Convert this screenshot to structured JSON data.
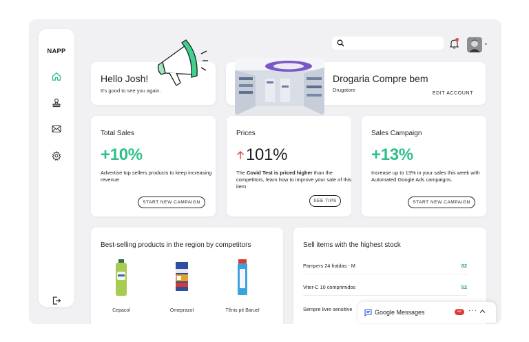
{
  "app": {
    "logo": "NAPP"
  },
  "sidebar": {
    "items": [
      {
        "icon": "home-icon"
      },
      {
        "icon": "stamp-icon"
      },
      {
        "icon": "mail-icon"
      },
      {
        "icon": "gear-icon"
      }
    ],
    "logout_icon": "logout-icon"
  },
  "greeting": {
    "title": "Hello Josh!",
    "subtitle": "It's good to see you again."
  },
  "store": {
    "name": "Drogaria Compre bem",
    "type": "Drugstore",
    "edit_label": "EDIT ACCOUNT"
  },
  "search": {
    "placeholder": ""
  },
  "colors": {
    "accent": "#2ec08a",
    "background": "#f1f1f4",
    "badge": "#d63a3a",
    "up_arrow": "#e23b3b",
    "stock_qty": "#2ba56d"
  },
  "cards": {
    "total_sales": {
      "title": "Total Sales",
      "value": "+10%",
      "desc": "Advertise top sellers products to keep increasing revenue",
      "button": "START NEW CAMPAIGN"
    },
    "prices": {
      "title": "Prices",
      "value": "101%",
      "desc_pre": "The ",
      "desc_bold": "Covid Test is priced higher",
      "desc_post": " than the competitors, learn how to improve your sale of this item",
      "button": "SEE TIPS"
    },
    "sales_campaign": {
      "title": "Sales Campaign",
      "value": "+13%",
      "desc": "Increase up to 13% in your sales this week with Automated Google Ads campaigns.",
      "button": "START NEW CAMPAIGN"
    }
  },
  "best_selling": {
    "title": "Best-selling products in the region by competitors",
    "products": [
      "Cepacol",
      "Omeprazol",
      "Tênis pé Baruel"
    ]
  },
  "stock": {
    "title": "Sell items with the highest stock",
    "rows": [
      {
        "name": "Pampers 24 fraldas - M",
        "qty": "82"
      },
      {
        "name": "Viter-C 10 comprimidos",
        "qty": "52"
      },
      {
        "name": "Sempre livre sensitive",
        "qty": ""
      }
    ]
  },
  "messages": {
    "label": "Google Messages",
    "count": "42"
  }
}
